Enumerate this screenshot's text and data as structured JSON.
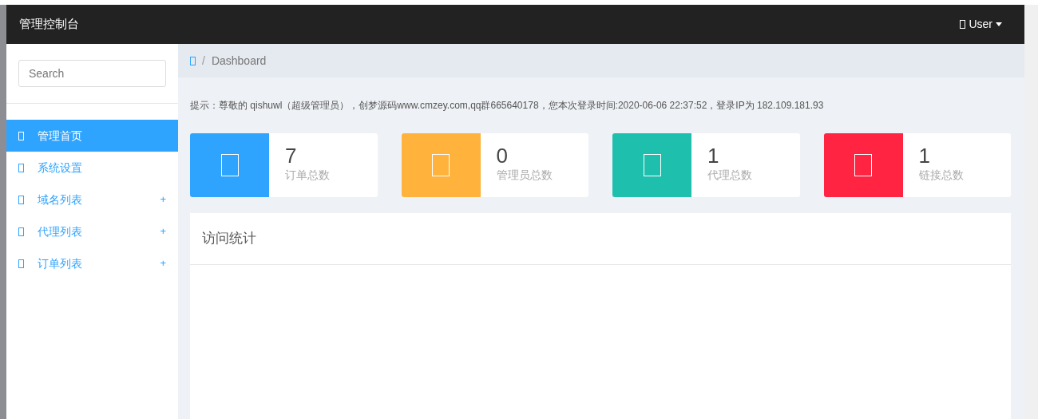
{
  "navbar": {
    "title": "管理控制台",
    "user_menu": "User"
  },
  "sidebar": {
    "search": {
      "placeholder": "Search"
    },
    "items": [
      {
        "label": "管理首页",
        "selected": true
      },
      {
        "label": "系统设置",
        "selected": false
      },
      {
        "label": "域名列表",
        "selected": false,
        "toggle": "+"
      },
      {
        "label": "代理列表",
        "selected": false,
        "toggle": "+"
      },
      {
        "label": "订单列表",
        "selected": false,
        "toggle": "+"
      }
    ]
  },
  "breadcrumb": {
    "separator": "/",
    "current": "Dashboard"
  },
  "notice": "提示：尊敬的 qishuwl（超级管理员），创梦源码www.cmzey.com,qq群665640178，您本次登录时间:2020-06-06 22:37:52，登录IP为 182.109.181.93",
  "stats": [
    {
      "value": "7",
      "label": "订单总数",
      "color": "#2fa4ff"
    },
    {
      "value": "0",
      "label": "管理员总数",
      "color": "#ffb33c"
    },
    {
      "value": "1",
      "label": "代理总数",
      "color": "#1fbfad"
    },
    {
      "value": "1",
      "label": "链接总数",
      "color": "#ff2442"
    }
  ],
  "panel": {
    "title": "访问统计"
  }
}
